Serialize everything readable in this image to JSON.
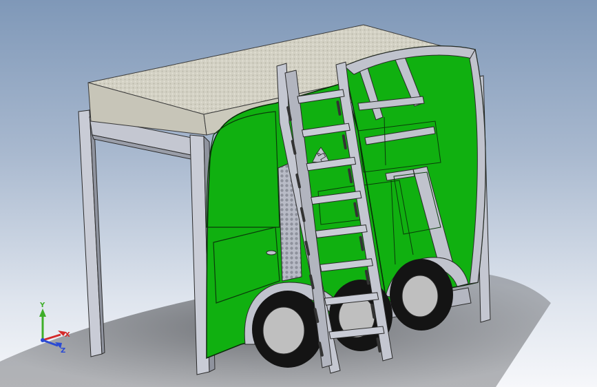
{
  "triad": {
    "y_label": "Y",
    "x_label": "X",
    "z_label": "Z",
    "y_color": "#3fae2a",
    "x_color": "#d42a2a",
    "z_color": "#2a4ad4"
  },
  "colors": {
    "body_green": "#10b010",
    "frame_gray": "#c0c3cd",
    "mattress": "#d4d2c6",
    "tire": "#141414",
    "hub": "#bfbfbf",
    "shadow": "#6e7074"
  },
  "icons": {
    "recycle": "recycle-icon"
  }
}
